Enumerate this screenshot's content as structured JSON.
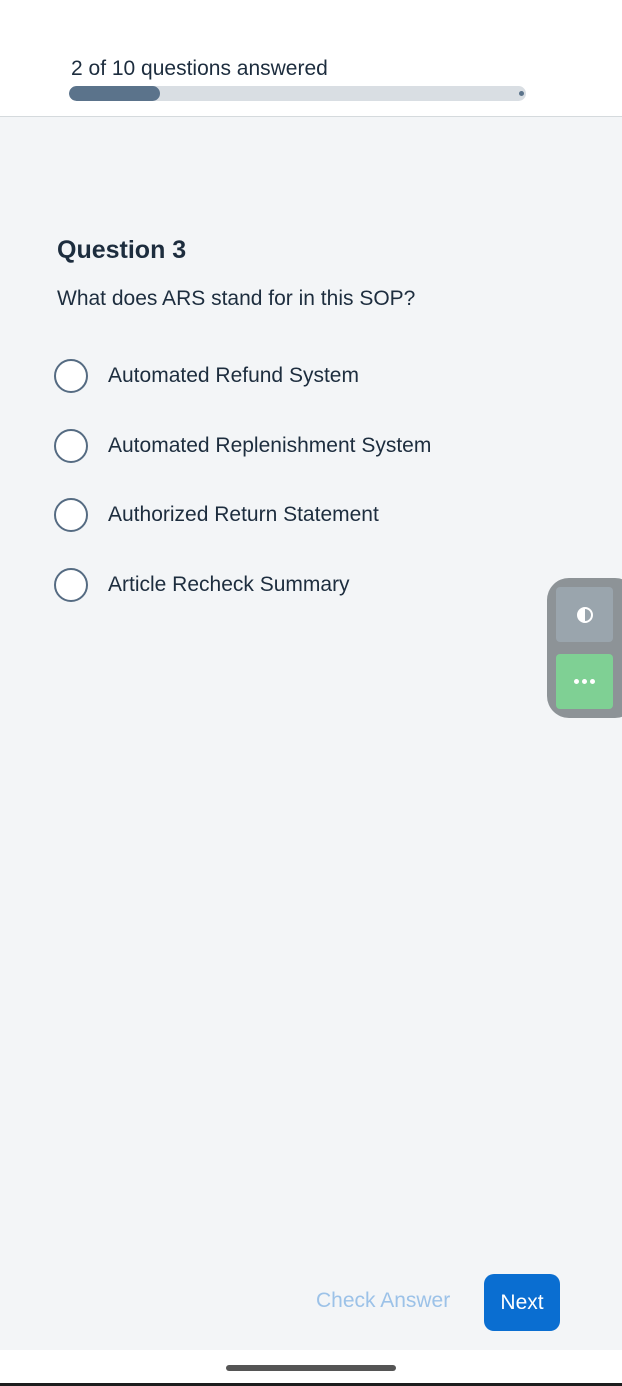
{
  "progress": {
    "text": "2 of 10 questions answered",
    "answered": 2,
    "total": 10
  },
  "question": {
    "title": "Question 3",
    "text": "What does ARS stand for in this SOP?",
    "options": [
      {
        "label": "Automated Refund System",
        "selected": false
      },
      {
        "label": "Automated Replenishment System",
        "selected": false
      },
      {
        "label": "Authorized Return Statement",
        "selected": false
      },
      {
        "label": "Article Recheck Summary",
        "selected": false
      }
    ]
  },
  "side_panel": {
    "contrast_icon": "contrast-icon",
    "more_icon": "more-dots-icon"
  },
  "footer": {
    "check_answer_label": "Check Answer",
    "next_label": "Next"
  },
  "colors": {
    "accent": "#0a6ed1",
    "progress_fill": "#5b738b",
    "disabled_text": "#9cc2e8",
    "more_button": "#7fd094"
  }
}
